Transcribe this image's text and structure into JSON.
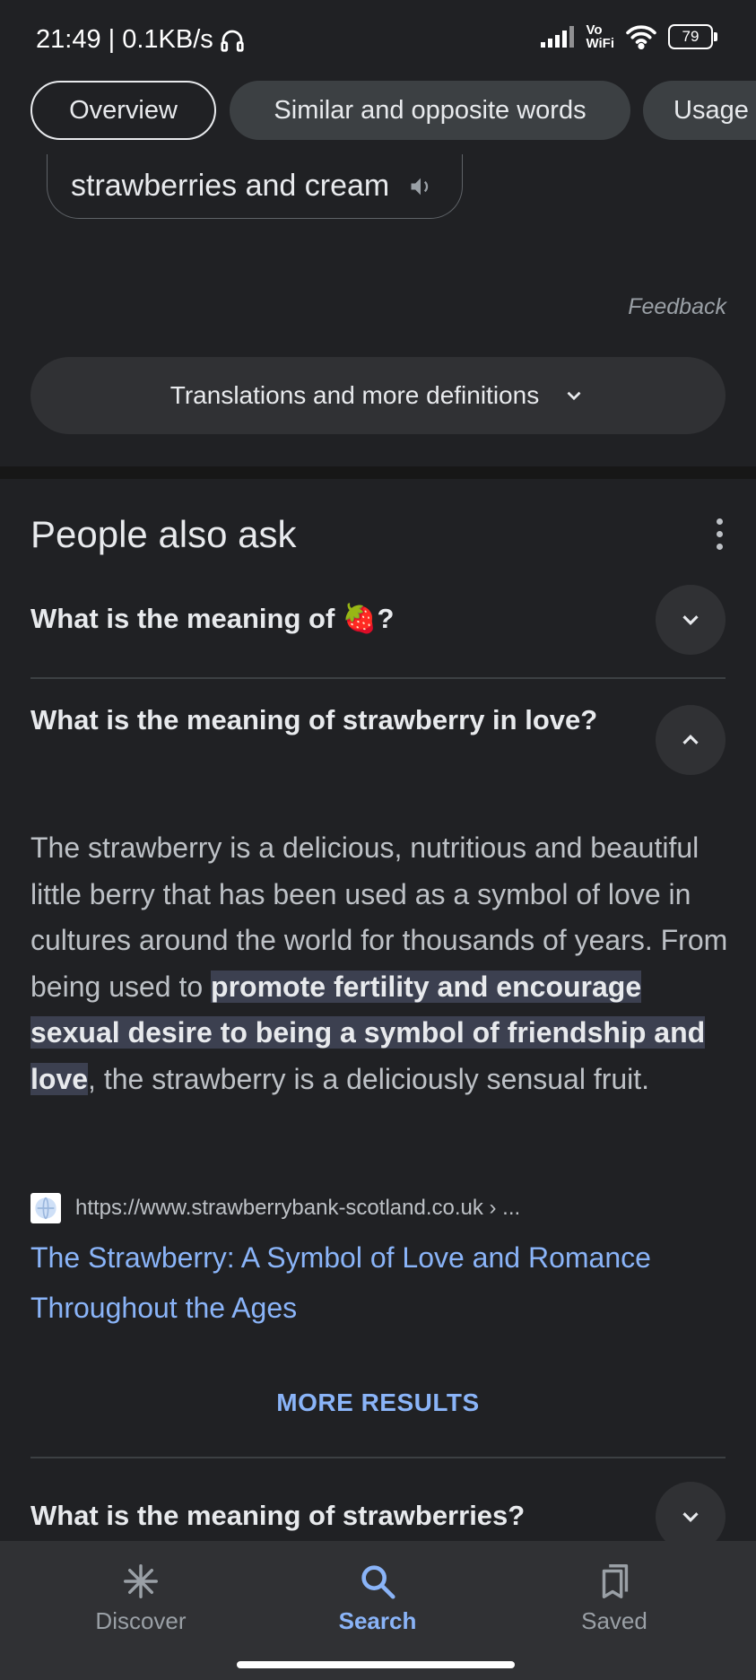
{
  "status": {
    "time_speed": "21:49 | 0.1KB/s",
    "vowifi": "Vo\nWiFi",
    "battery": "79"
  },
  "chips": [
    "Overview",
    "Similar and opposite words",
    "Usage"
  ],
  "phrase": "strawberries and cream",
  "feedback": "Feedback",
  "translations_label": "Translations and more definitions",
  "paa": {
    "title": "People also ask",
    "questions": [
      "What is the meaning of 🍓?",
      "What is the meaning of strawberry in love?",
      "What is the meaning of strawberries?"
    ],
    "answer": {
      "before": "The strawberry is a delicious, nutritious and beautiful little berry that has been used as a symbol of love in cultures around the world for thousands of years. From being used to ",
      "highlight": "promote fertility and encourage sexual desire to being a symbol of friendship and love",
      "after": ", the strawberry is a deliciously sensual fruit."
    },
    "source_url": "https://www.strawberrybank-scotland.co.uk › ...",
    "link_title": "The Strawberry: A Symbol of Love and Romance Throughout the Ages",
    "more_results": "MORE RESULTS"
  },
  "nav": [
    {
      "label": "Discover",
      "icon": "asterisk-icon"
    },
    {
      "label": "Search",
      "icon": "search-icon"
    },
    {
      "label": "Saved",
      "icon": "bookmarks-icon"
    }
  ],
  "colors": {
    "background": "#202124",
    "accent": "#8ab4f8"
  }
}
